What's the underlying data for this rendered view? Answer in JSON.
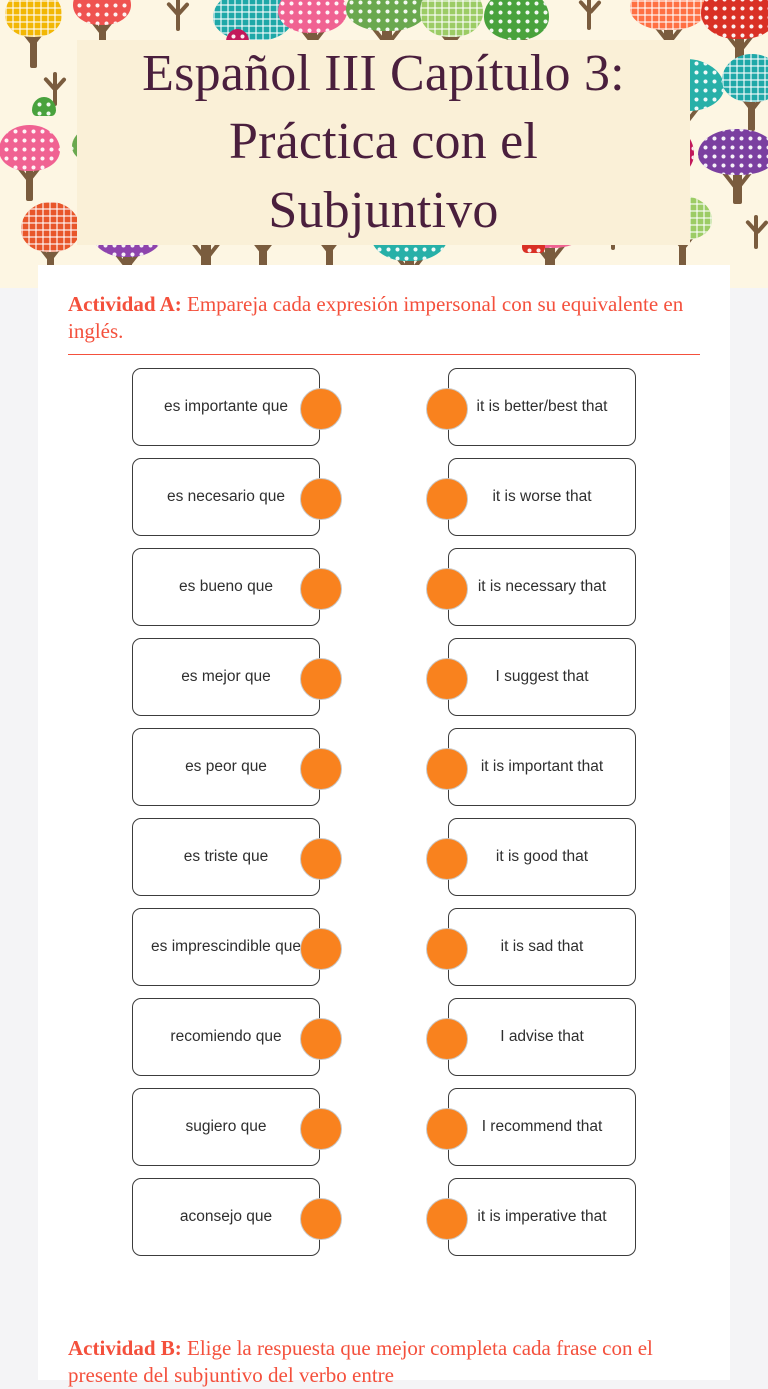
{
  "page": {
    "title_lines": [
      "Español III Capítulo 3:",
      "Práctica con el",
      "Subjuntivo"
    ],
    "title_full": "Español III Capítulo 3: Práctica con el Subjuntivo",
    "colors": {
      "title_text": "#4a1f3d",
      "title_card_bg": "#faf0d7",
      "banner_bg": "#fdf6e3",
      "accent_red": "#f4503c",
      "marker_orange": "#F9821E",
      "marker_ring": "#c9c9c9",
      "card_border": "#3c3c3c",
      "sheet_bg": "#ffffff",
      "page_bg": "#f4f4f6"
    }
  },
  "activity_a": {
    "label": "Actividad A:",
    "instruction": "Empareja cada expresión impersonal con su equivalente en inglés.",
    "left_items": [
      "es importante que",
      "es necesario que",
      "es bueno que",
      "es mejor que",
      "es peor que",
      "es triste que",
      "es imprescindible que",
      "recomiendo que",
      "sugiero que",
      "aconsejo que"
    ],
    "right_items": [
      "it is better/best that",
      "it is worse that",
      "it is necessary that",
      "I suggest that",
      "it is important that",
      "it is good that",
      "it is sad that",
      "I advise that",
      "I recommend that",
      "it is imperative that"
    ]
  },
  "activity_b": {
    "label": "Actividad B:",
    "instruction": "Elige la respuesta que mejor completa cada frase con el presente del subjuntivo del verbo entre"
  }
}
